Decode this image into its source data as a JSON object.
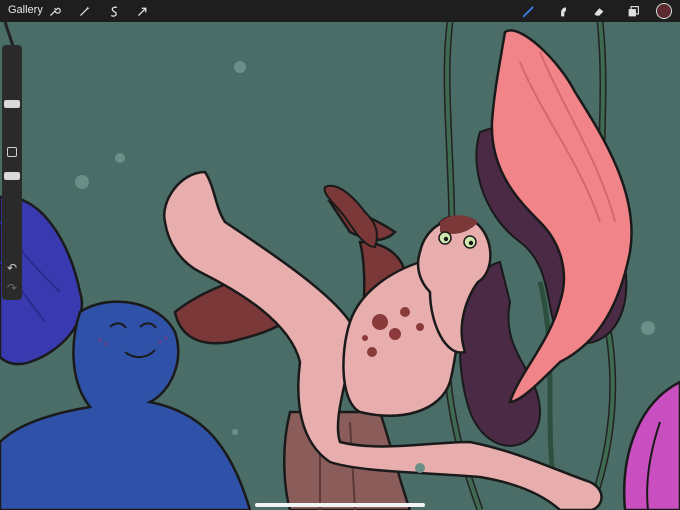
{
  "toolbar": {
    "gallery_label": "Gallery",
    "left_icons": [
      "wrench-icon",
      "magic-wand-icon",
      "selection-s-icon",
      "transform-arrow-icon"
    ],
    "right_icons": [
      "brush-icon",
      "smudge-icon",
      "eraser-icon",
      "layers-icon"
    ],
    "active_color": "#5a2a2f",
    "brush_active_color": "#3f7cf0"
  },
  "sidebar": {
    "brush_size_level": 0.6,
    "opacity_level": 0.55,
    "buttons": [
      "modify-square-icon",
      "undo-icon",
      "redo-icon"
    ]
  },
  "canvas": {
    "background_color": "#4a6d68"
  }
}
